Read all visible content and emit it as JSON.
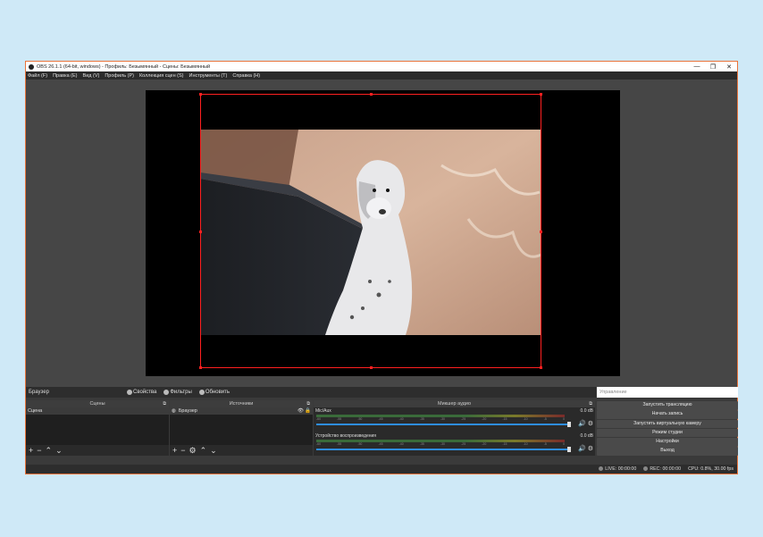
{
  "window": {
    "title": "OBS 26.1.1 (64-bit, windows) - Профиль: Безымянный - Сцены: Безымянный",
    "controls": {
      "minimize": "—",
      "maximize": "❐",
      "close": "✕"
    }
  },
  "menu": [
    "Файл (F)",
    "Правка (E)",
    "Вид (V)",
    "Профиль (P)",
    "Коллекция сцен (S)",
    "Инструменты (T)",
    "Справка (H)"
  ],
  "context_bar": {
    "source_name": "Браузер",
    "properties": "Свойства",
    "filters": "Фильтры",
    "refresh": "Обновить"
  },
  "controls_panel": {
    "placeholder": "Управление",
    "buttons": [
      "Запустить трансляцию",
      "Начать запись",
      "Запустить виртуальную камеру",
      "Режим студии",
      "Настройки",
      "Выход"
    ]
  },
  "scenes": {
    "header": "Сцены",
    "items": [
      "Сцена"
    ]
  },
  "sources": {
    "header": "Источники",
    "items": [
      "Браузер"
    ]
  },
  "mixer": {
    "header": "Микшер аудио",
    "channels": [
      {
        "name": "Mic/Aux",
        "db": "0.0 dB"
      },
      {
        "name": "Устройство воспроизведения",
        "db": "0.0 dB"
      }
    ],
    "ticks": [
      "-60",
      "-55",
      "-50",
      "-45",
      "-40",
      "-35",
      "-30",
      "-25",
      "-20",
      "-15",
      "-10",
      "-5",
      "0"
    ]
  },
  "status": {
    "live": "LIVE: 00:00:00",
    "rec": "REC: 00:00:00",
    "cpu": "CPU: 0.8%, 30.00 fps"
  },
  "colors": {
    "accent_border": "#e8733a",
    "selection": "#ff2020",
    "volume": "#2e8de0"
  }
}
